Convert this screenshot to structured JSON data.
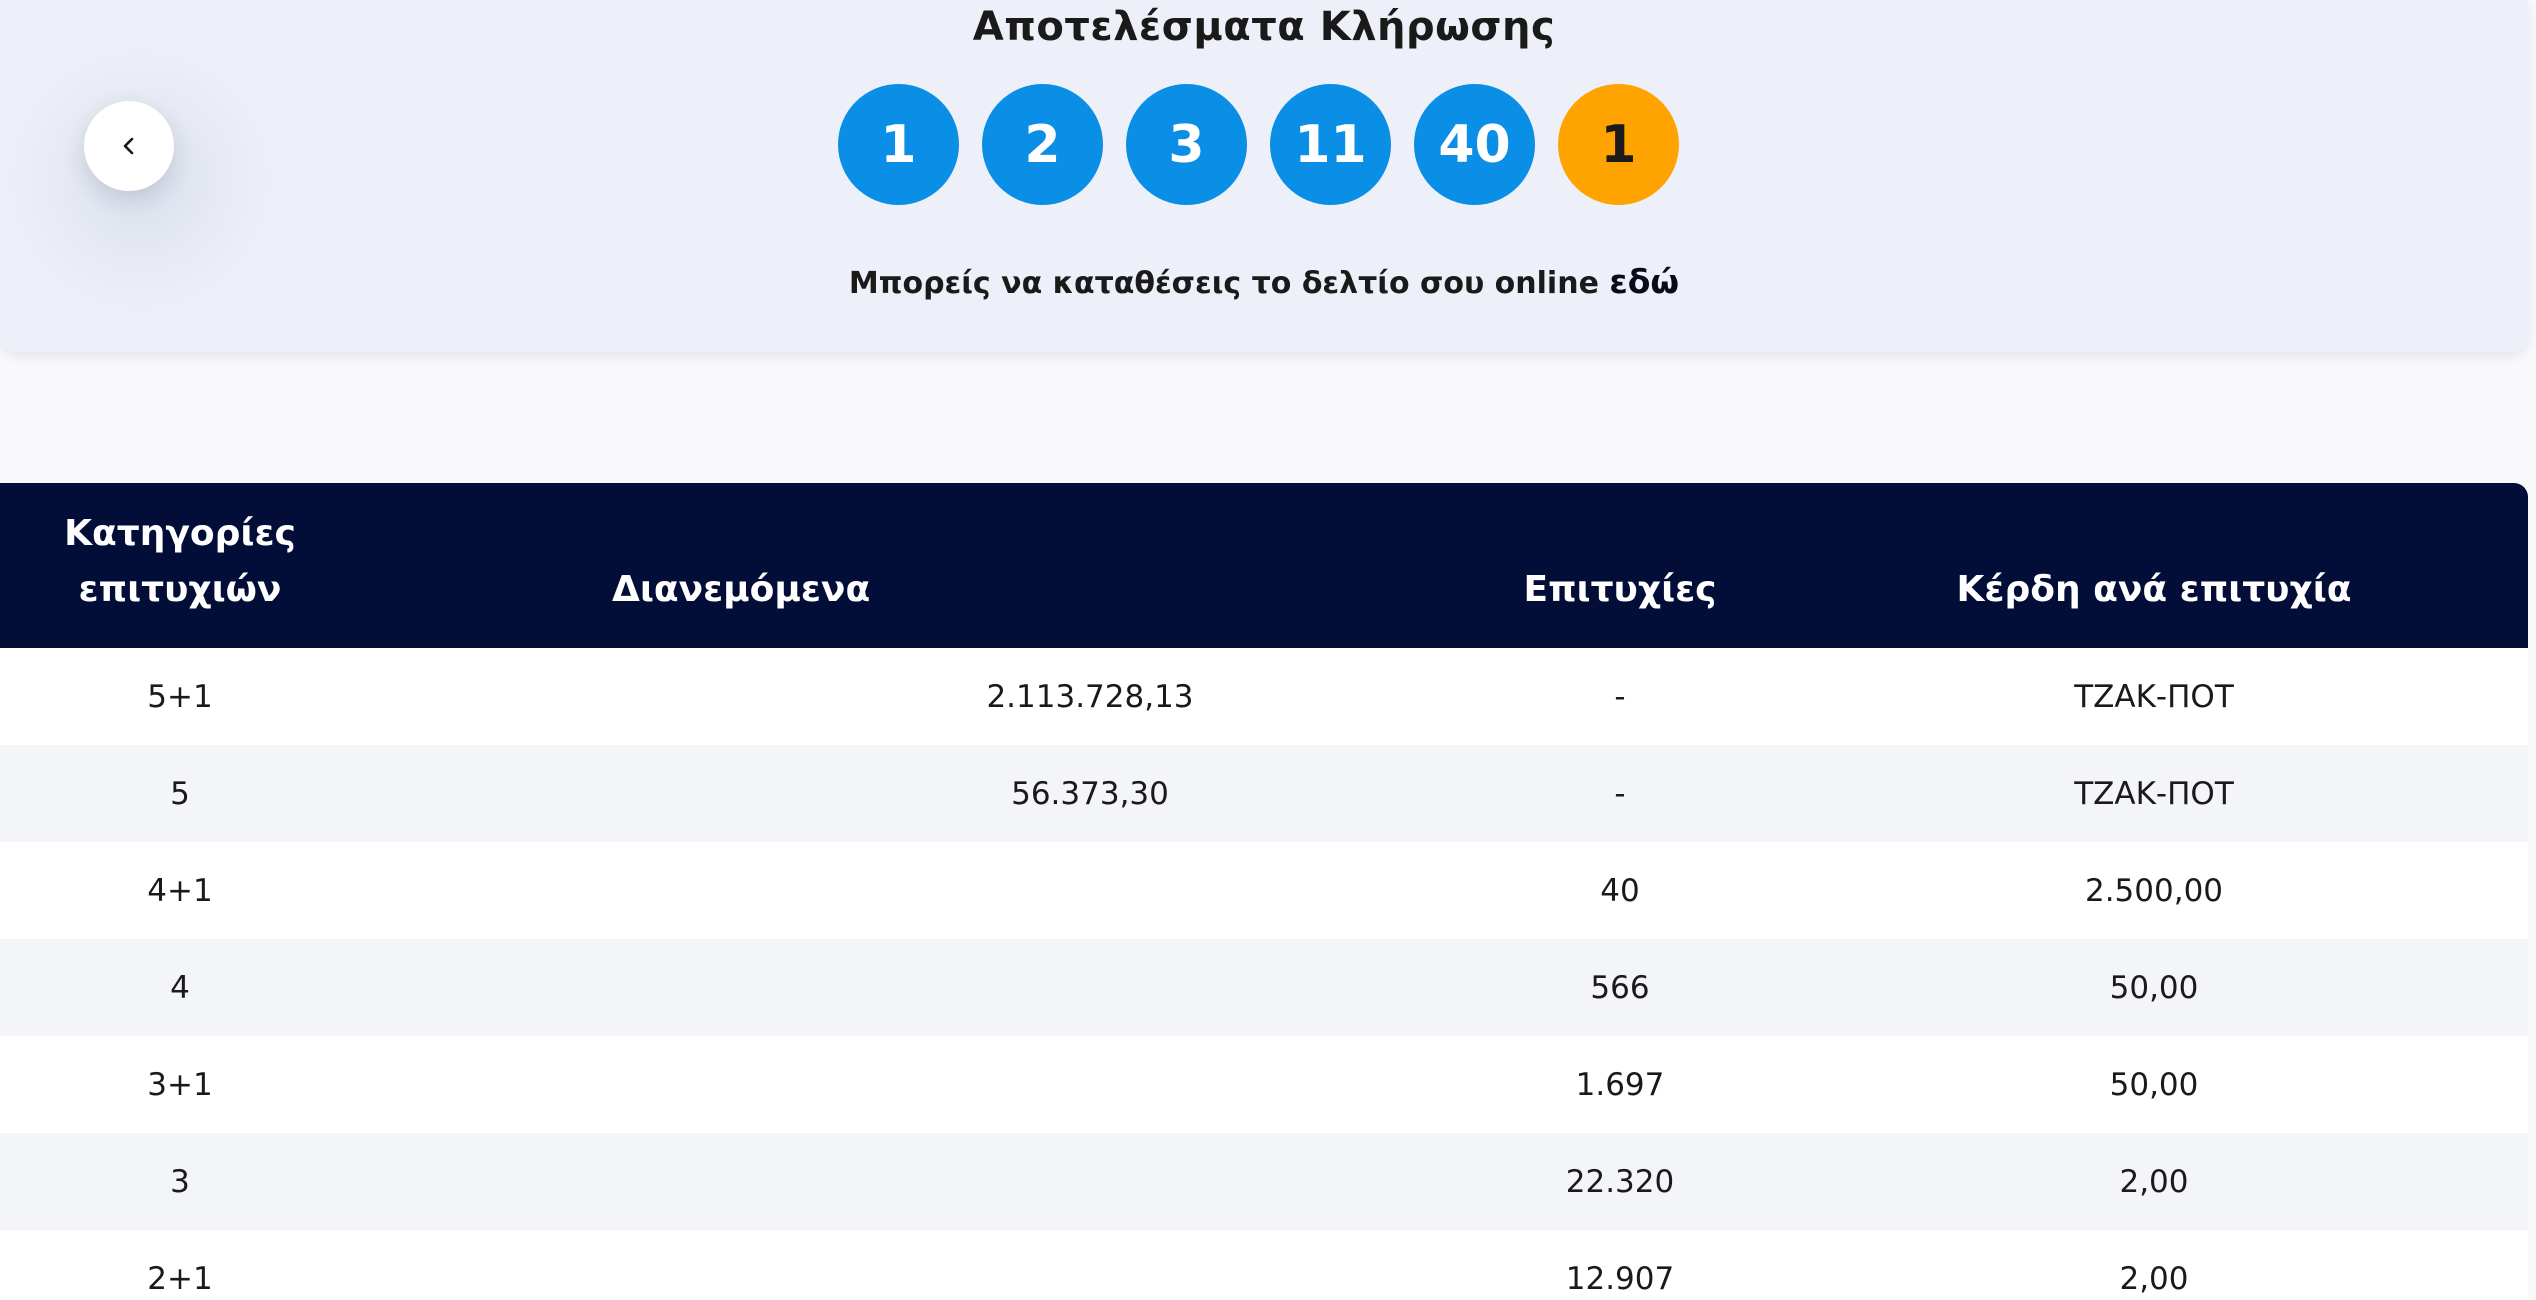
{
  "results": {
    "title": "Αποτελέσματα Κλήρωσης",
    "numbers": [
      "1",
      "2",
      "3",
      "11",
      "40"
    ],
    "bonus": "1",
    "online_text": "Μπορείς να καταθέσεις το δελτίο σου online",
    "online_link": "εδώ"
  },
  "colors": {
    "ball": "#0a8ee6",
    "bonus_ball": "#ffa300",
    "table_header": "#020e38"
  },
  "table": {
    "headers": {
      "category": "Κατηγορίες επιτυχιών",
      "distributed": "Διανεμόμενα",
      "winners": "Επιτυχίες",
      "prize": "Κέρδη ανά επιτυχία"
    },
    "rows": [
      {
        "category": "5+1",
        "distributed": "2.113.728,13",
        "winners": "-",
        "prize": "ΤΖΑΚ-ΠΟΤ"
      },
      {
        "category": "5",
        "distributed": "56.373,30",
        "winners": "-",
        "prize": "ΤΖΑΚ-ΠΟΤ"
      },
      {
        "category": "4+1",
        "distributed": "",
        "winners": "40",
        "prize": "2.500,00"
      },
      {
        "category": "4",
        "distributed": "",
        "winners": "566",
        "prize": "50,00"
      },
      {
        "category": "3+1",
        "distributed": "",
        "winners": "1.697",
        "prize": "50,00"
      },
      {
        "category": "3",
        "distributed": "",
        "winners": "22.320",
        "prize": "2,00"
      },
      {
        "category": "2+1",
        "distributed": "",
        "winners": "12.907",
        "prize": "2,00"
      }
    ]
  }
}
